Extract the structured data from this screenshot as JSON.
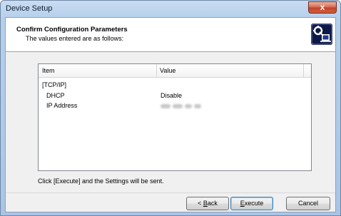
{
  "window": {
    "title": "Device Setup",
    "close_glyph": "x"
  },
  "header": {
    "title": "Confirm Configuration Parameters",
    "subtitle": "The values entered are as follows:",
    "icon": "device-config-icon"
  },
  "table": {
    "columns": [
      "Item",
      "Value"
    ],
    "rows": [
      {
        "item": "[TCP/IP]",
        "value": ""
      },
      {
        "item": "DHCP",
        "value": "Disable"
      },
      {
        "item": "IP Address",
        "value": ""
      }
    ]
  },
  "hint": "Click [Execute] and the Settings will be sent.",
  "buttons": {
    "back_prefix": "< ",
    "back_key": "B",
    "back_rest": "ack",
    "execute_key": "E",
    "execute_rest": "xecute",
    "cancel": "Cancel"
  }
}
